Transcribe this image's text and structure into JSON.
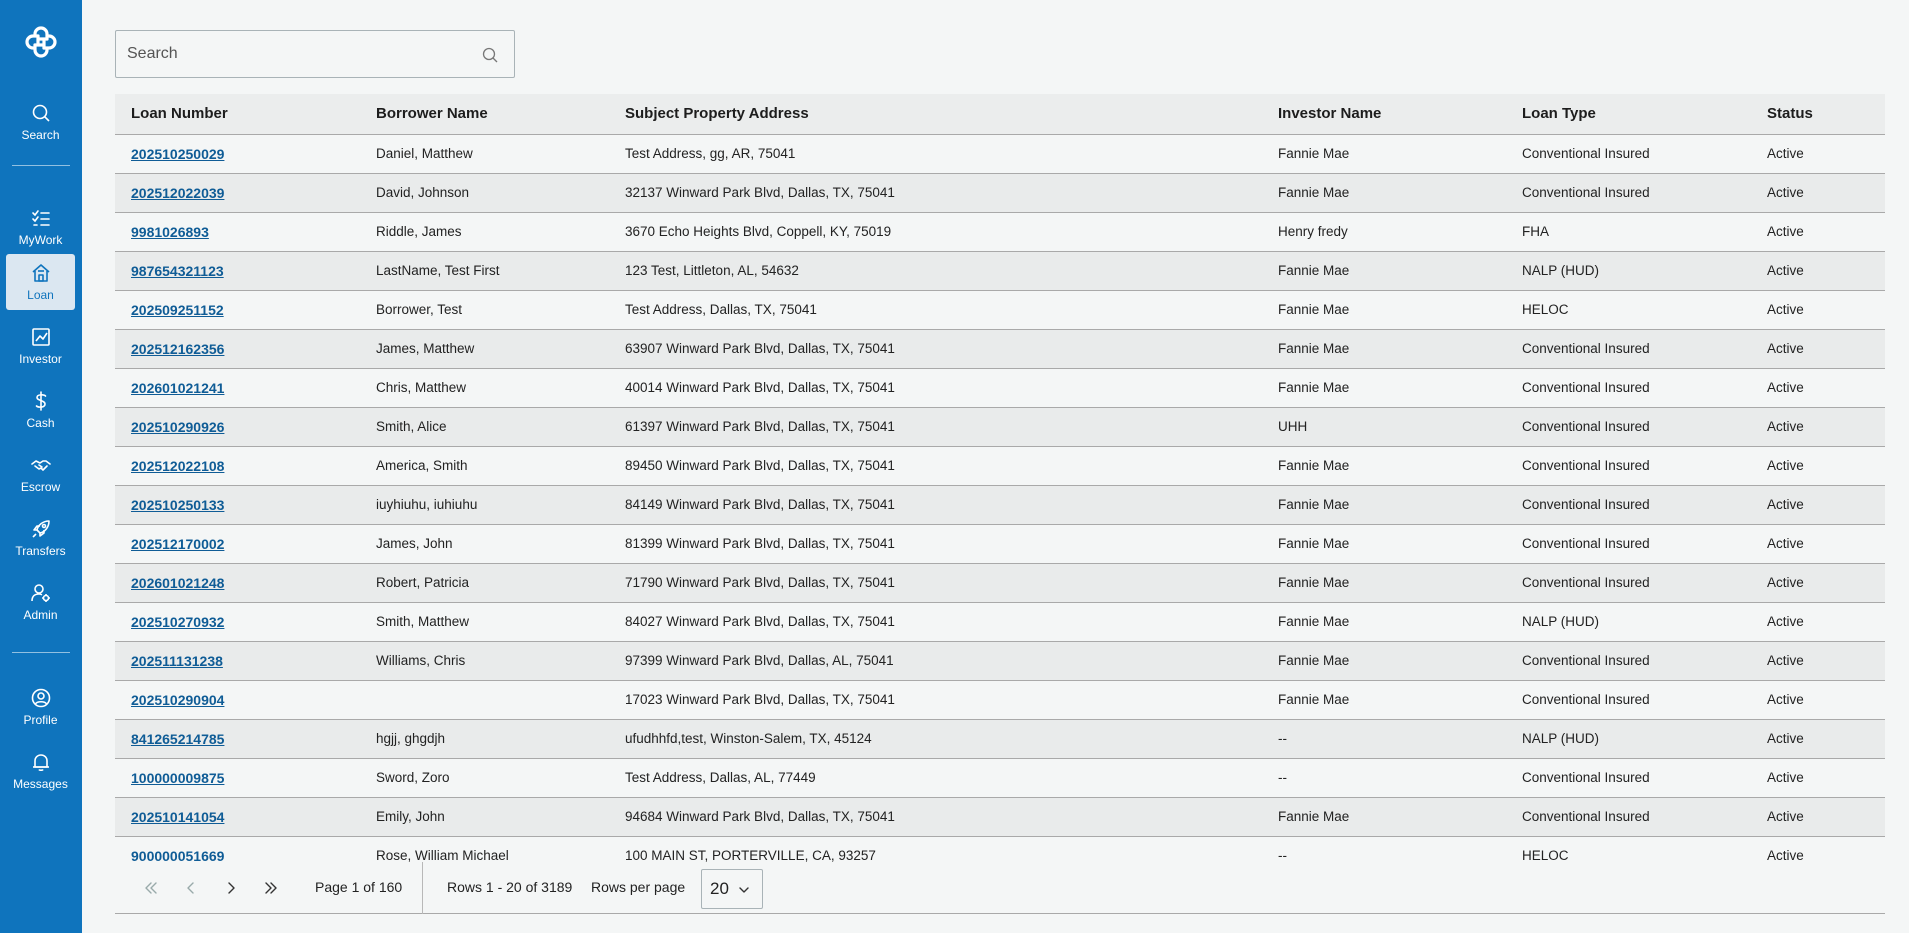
{
  "sidebar": {
    "nav": [
      {
        "label": "Search",
        "icon": "search-icon"
      },
      {
        "label": "MyWork",
        "icon": "checklist-icon"
      },
      {
        "label": "Loan",
        "icon": "house-icon"
      },
      {
        "label": "Investor",
        "icon": "chart-icon"
      },
      {
        "label": "Cash",
        "icon": "dollar-icon"
      },
      {
        "label": "Escrow",
        "icon": "handshake-icon"
      },
      {
        "label": "Transfers",
        "icon": "rocket-icon"
      },
      {
        "label": "Admin",
        "icon": "admin-icon"
      }
    ],
    "bottom": [
      {
        "label": "Profile",
        "icon": "user-circle-icon"
      },
      {
        "label": "Messages",
        "icon": "bell-icon"
      }
    ],
    "active": "Loan",
    "bg_color": "#0f74bd"
  },
  "search": {
    "placeholder": "Search"
  },
  "table": {
    "columns": [
      "Loan Number",
      "Borrower Name",
      "Subject Property Address",
      "Investor Name",
      "Loan Type",
      "Status"
    ],
    "rows": [
      [
        "202510250029",
        "Daniel, Matthew",
        "Test Address, gg, AR, 75041",
        "Fannie Mae",
        "Conventional Insured",
        "Active"
      ],
      [
        "202512022039",
        "David, Johnson",
        "32137 Winward Park Blvd, Dallas, TX, 75041",
        "Fannie Mae",
        "Conventional Insured",
        "Active"
      ],
      [
        "9981026893",
        "Riddle, James",
        "3670 Echo Heights Blvd, Coppell, KY, 75019",
        "Henry fredy",
        "FHA",
        "Active"
      ],
      [
        "987654321123",
        "LastName, Test First",
        "123 Test, Littleton, AL, 54632",
        "Fannie Mae",
        "NALP (HUD)",
        "Active"
      ],
      [
        "202509251152",
        "Borrower, Test",
        "Test Address, Dallas, TX, 75041",
        "Fannie Mae",
        "HELOC",
        "Active"
      ],
      [
        "202512162356",
        "James, Matthew",
        "63907 Winward Park Blvd, Dallas, TX, 75041",
        "Fannie Mae",
        "Conventional Insured",
        "Active"
      ],
      [
        "202601021241",
        "Chris, Matthew",
        "40014 Winward Park Blvd, Dallas, TX, 75041",
        "Fannie Mae",
        "Conventional Insured",
        "Active"
      ],
      [
        "202510290926",
        "Smith, Alice",
        "61397 Winward Park Blvd, Dallas, TX, 75041",
        "UHH",
        "Conventional Insured",
        "Active"
      ],
      [
        "202512022108",
        "America, Smith",
        "89450 Winward Park Blvd, Dallas, TX, 75041",
        "Fannie Mae",
        "Conventional Insured",
        "Active"
      ],
      [
        "202510250133",
        "iuyhiuhu, iuhiuhu",
        "84149 Winward Park Blvd, Dallas, TX, 75041",
        "Fannie Mae",
        "Conventional Insured",
        "Active"
      ],
      [
        "202512170002",
        "James, John",
        "81399 Winward Park Blvd, Dallas, TX, 75041",
        "Fannie Mae",
        "Conventional Insured",
        "Active"
      ],
      [
        "202601021248",
        "Robert, Patricia",
        "71790 Winward Park Blvd, Dallas, TX, 75041",
        "Fannie Mae",
        "Conventional Insured",
        "Active"
      ],
      [
        "202510270932",
        "Smith, Matthew",
        "84027 Winward Park Blvd, Dallas, TX, 75041",
        "Fannie Mae",
        "NALP (HUD)",
        "Active"
      ],
      [
        "202511131238",
        "Williams, Chris",
        "97399 Winward Park Blvd, Dallas, AL, 75041",
        "Fannie Mae",
        "Conventional Insured",
        "Active"
      ],
      [
        "202510290904",
        "",
        "17023 Winward Park Blvd, Dallas, TX, 75041",
        "Fannie Mae",
        "Conventional Insured",
        "Active"
      ],
      [
        "841265214785",
        "hgjj, ghgdjh",
        "ufudhhfd,test, Winston-Salem, TX, 45124",
        "--",
        "NALP (HUD)",
        "Active"
      ],
      [
        "100000009875",
        "Sword, Zoro",
        "Test Address, Dallas, AL, 77449",
        "--",
        "Conventional Insured",
        "Active"
      ],
      [
        "202510141054",
        "Emily, John",
        "94684 Winward Park Blvd, Dallas, TX, 75041",
        "Fannie Mae",
        "Conventional Insured",
        "Active"
      ],
      [
        "900000051669",
        "Rose, William Michael",
        "100 MAIN ST, PORTERVILLE, CA, 93257",
        "--",
        "HELOC",
        "Active"
      ]
    ]
  },
  "pagination": {
    "page_text": "Page 1 of 160",
    "rows_text": "Rows 1 - 20 of 3189",
    "rows_per_page_label": "Rows per page",
    "rows_per_page": "20"
  }
}
